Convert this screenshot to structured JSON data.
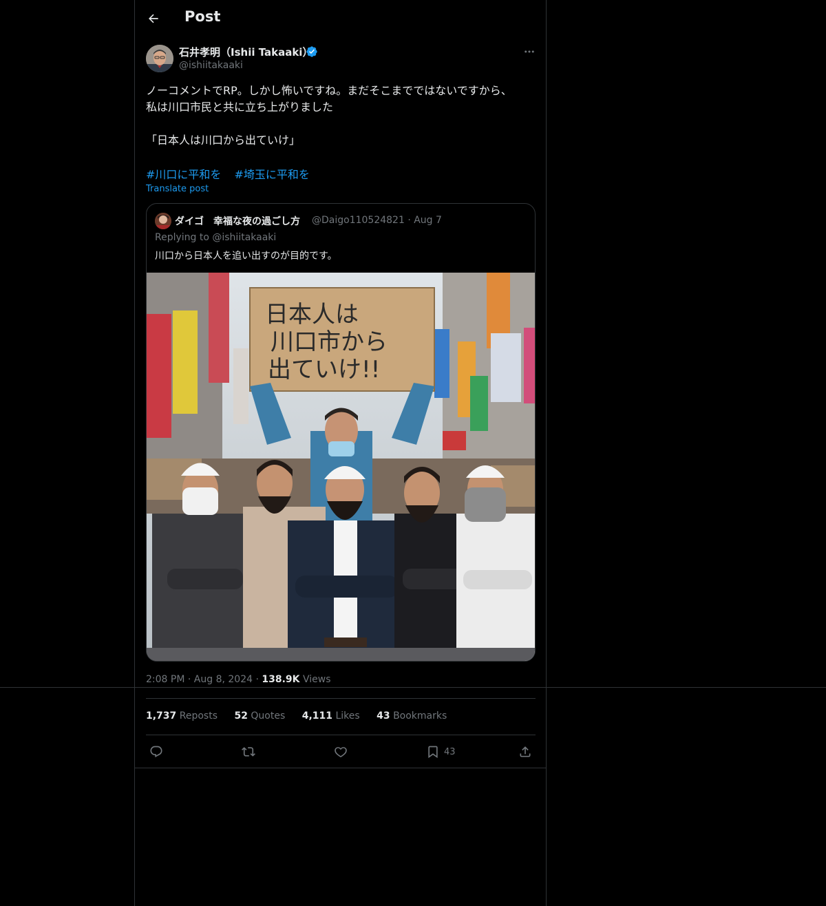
{
  "header": {
    "title": "Post",
    "back_icon": "arrow-left-icon"
  },
  "author": {
    "name": "石井孝明（Ishii Takaaki）",
    "handle": "@ishiitakaaki",
    "verified_color": "#1d9bf0"
  },
  "tweet": {
    "lines": [
      "ノーコメントでRP。しかし怖いですね。まだそこまでではないですから、",
      "私は川口市民と共に立ち上がりました",
      "「日本人は川口から出ていけ」"
    ],
    "hashtags": [
      "#川口に平和を",
      "#埼玉に平和を"
    ],
    "translate_label": "Translate post"
  },
  "quote": {
    "name": "ダイゴ　幸福な夜の過ごし方",
    "handle": "@Daigo110524821",
    "date": "Aug 7",
    "replying_to": "Replying to @ishiitakaaki",
    "text": "川口から日本人を追い出すのが目的です。",
    "image_sign_lines": [
      "日本人は",
      "川口市から",
      "出ていけ!!"
    ]
  },
  "post_meta": {
    "time": "2:08 PM",
    "date": "Aug 8, 2024",
    "views_count": "138.9K",
    "views_label": "Views"
  },
  "stats": {
    "reposts_count": "1,737",
    "reposts_label": "Reposts",
    "quotes_count": "52",
    "quotes_label": "Quotes",
    "likes_count": "4,111",
    "likes_label": "Likes",
    "bookmarks_count": "43",
    "bookmarks_label": "Bookmarks"
  },
  "actions": {
    "reply_icon": "reply-icon",
    "repost_icon": "repost-icon",
    "like_icon": "heart-icon",
    "bookmark_icon": "bookmark-icon",
    "bookmark_count": "43",
    "share_icon": "share-icon"
  },
  "colors": {
    "background": "#000000",
    "text": "#e7e9ea",
    "muted": "#71767b",
    "accent": "#1d9bf0",
    "border": "#2f3336"
  }
}
